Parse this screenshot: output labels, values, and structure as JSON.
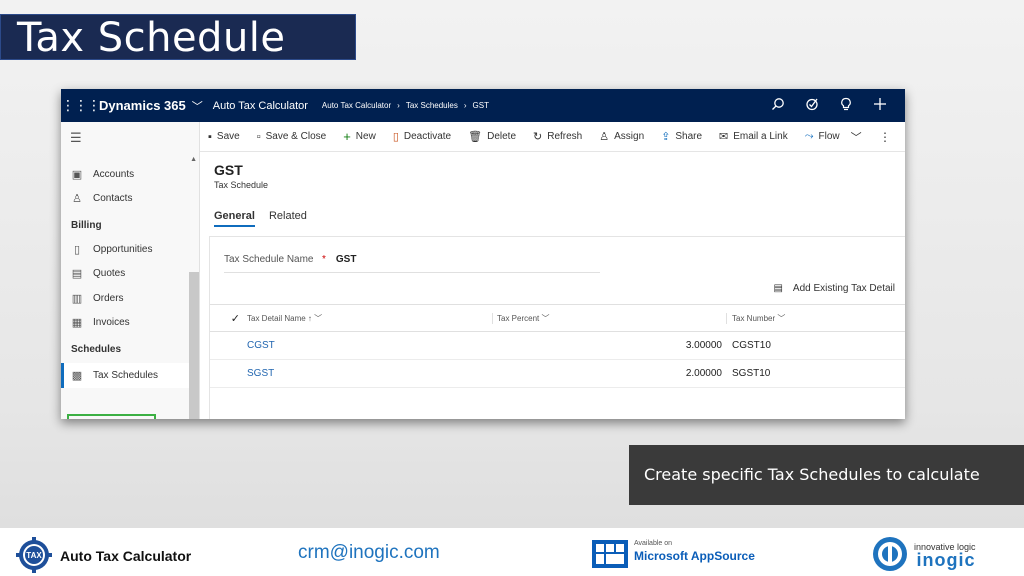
{
  "slide": {
    "title": "Tax Schedule",
    "caption": "Create specific Tax Schedules to calculate taxes"
  },
  "nav": {
    "brand": "Dynamics 365",
    "app_name": "Auto Tax Calculator",
    "breadcrumbs": [
      "Auto Tax Calculator",
      "Tax Schedules",
      "GST"
    ]
  },
  "sidebar": {
    "items_top": [
      {
        "label": "Accounts",
        "icon": "accounts-icon"
      },
      {
        "label": "Contacts",
        "icon": "contacts-icon"
      }
    ],
    "group_billing": "Billing",
    "items_billing": [
      {
        "label": "Opportunities",
        "icon": "opportunities-icon"
      },
      {
        "label": "Quotes",
        "icon": "quotes-icon"
      },
      {
        "label": "Orders",
        "icon": "orders-icon"
      },
      {
        "label": "Invoices",
        "icon": "invoices-icon"
      }
    ],
    "group_schedules": "Schedules",
    "active_item": "Tax Schedules"
  },
  "commands": {
    "save": "Save",
    "save_close": "Save & Close",
    "new": "New",
    "deactivate": "Deactivate",
    "delete": "Delete",
    "refresh": "Refresh",
    "assign": "Assign",
    "share": "Share",
    "email_link": "Email a Link",
    "flow": "Flow"
  },
  "record": {
    "title": "GST",
    "entity": "Tax Schedule",
    "tabs": [
      "General",
      "Related"
    ],
    "field_label": "Tax Schedule Name",
    "field_required": "*",
    "field_value": "GST",
    "add_existing": "Add Existing Tax Detail"
  },
  "grid": {
    "headers": {
      "name": "Tax Detail Name",
      "percent": "Tax Percent",
      "number": "Tax Number"
    },
    "rows": [
      {
        "name": "CGST",
        "percent": "3.00000",
        "number": "CGST10"
      },
      {
        "name": "SGST",
        "percent": "2.00000",
        "number": "SGST10"
      }
    ]
  },
  "footer": {
    "product": "Auto Tax Calculator",
    "logo_text": "TAX",
    "email": "crm@inogic.com",
    "ms_available": "Available on",
    "ms_name": "Microsoft AppSource",
    "ino_tag": "innovative logic",
    "ino_name": "inogic"
  },
  "colors": {
    "nav_bg": "#002050",
    "title_bg": "#1a2a52",
    "caption_bg": "#3a3a3a",
    "link": "#2266b0",
    "active_outline": "#3cb043"
  }
}
